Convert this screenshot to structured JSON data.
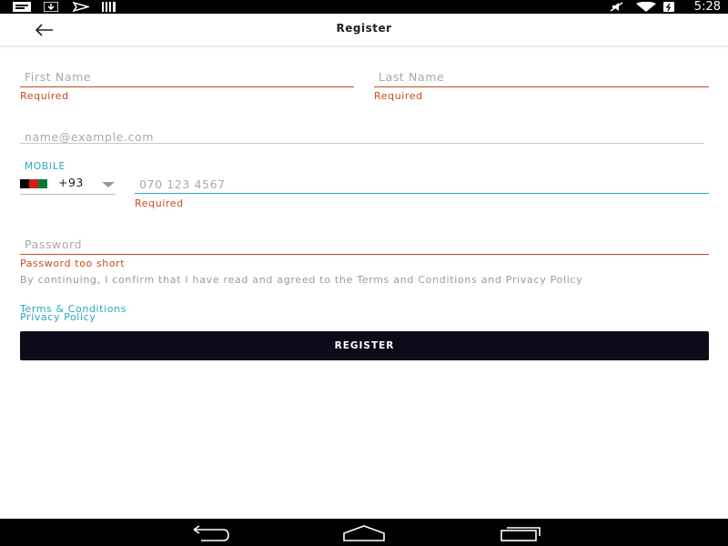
{
  "status_bar": {
    "time": "5:28",
    "left_icons": [
      "message-icon",
      "download-icon",
      "send-icon",
      "barcode-icon"
    ],
    "right_icons": [
      "mute-icon",
      "wifi-icon",
      "battery-icon"
    ]
  },
  "app_bar": {
    "back_icon": "arrow-left-icon",
    "title": "Register"
  },
  "form": {
    "first_name": {
      "placeholder": "First Name",
      "value": "",
      "error": "Required"
    },
    "last_name": {
      "placeholder": "Last Name",
      "value": "",
      "error": "Required"
    },
    "email": {
      "placeholder": "name@example.com",
      "value": ""
    },
    "mobile": {
      "label": "MOBILE",
      "country_code": "+93",
      "flag_colors": [
        "#000000",
        "#d32011",
        "#007a36"
      ],
      "placeholder": "070 123 4567",
      "value": "",
      "error": "Required"
    },
    "password": {
      "placeholder": "Password",
      "value": "",
      "error": "Password too short"
    }
  },
  "consent": {
    "text": "By continuing, I confirm that I have read and agreed to the Terms and Conditions and Privacy Policy",
    "terms_link": "Terms & Conditions",
    "privacy_link": "Privacy Policy"
  },
  "register_button": {
    "label": "REGISTER"
  },
  "colors": {
    "error": "#c84b1e",
    "accent": "#2aa7c4",
    "button_bg": "#0c0b1a"
  },
  "nav_bar": {
    "buttons": [
      "back-icon",
      "home-icon",
      "recents-icon"
    ]
  }
}
